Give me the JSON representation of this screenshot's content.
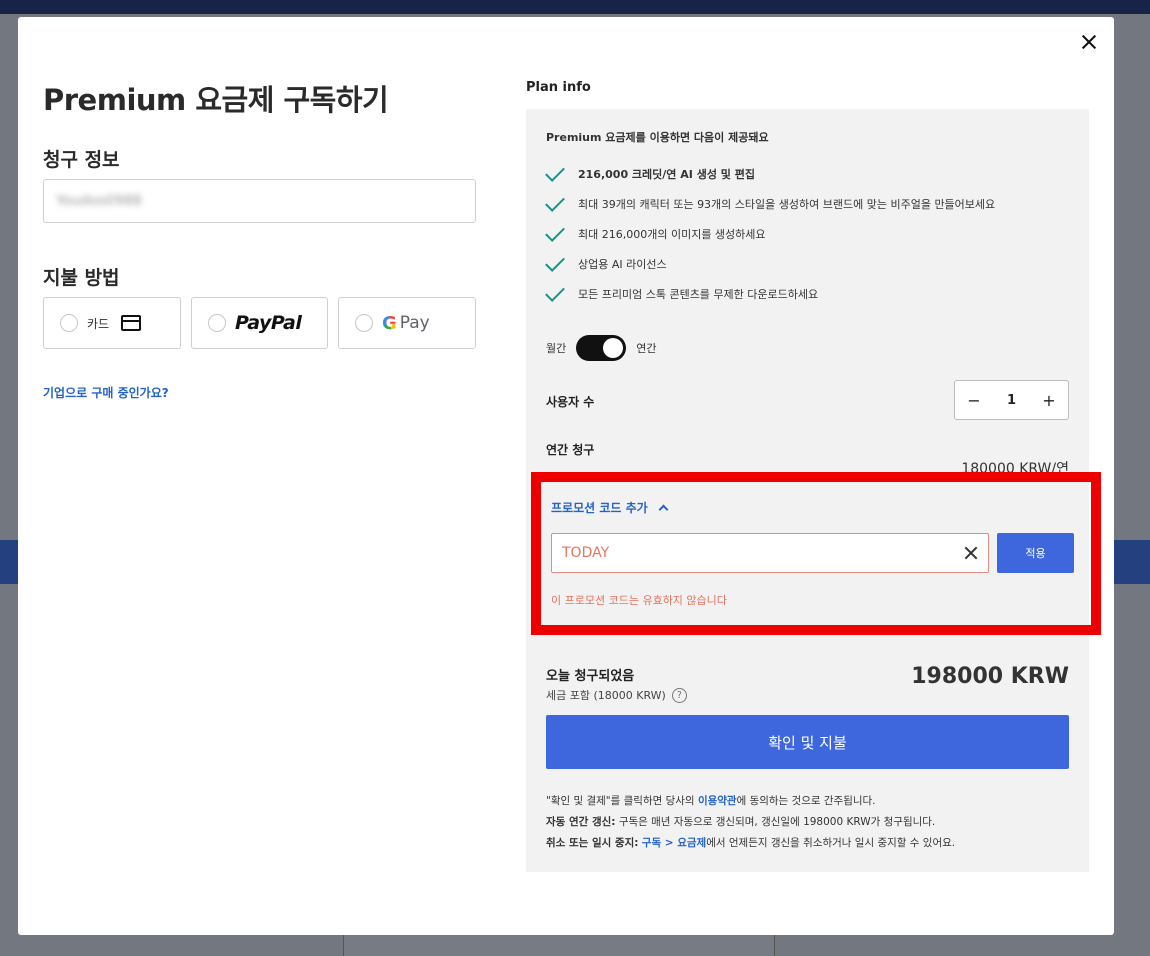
{
  "modal": {
    "title": "Premium 요금제 구독하기",
    "billing_section": "청구 정보",
    "billing_value": "Youdoo0988",
    "payment_section": "지불 방법",
    "payment_options": [
      {
        "label": "카드",
        "icon": "credit-card-icon"
      },
      {
        "label": "PayPal",
        "icon": "paypal-logo"
      },
      {
        "label": "Pay",
        "icon": "google-pay-logo"
      }
    ],
    "enterprise_link": "기업으로 구매 중인가요?"
  },
  "plan": {
    "heading": "Plan info",
    "intro": "Premium 요금제를 이용하면 다음이 제공돼요",
    "features": [
      "216,000 크레딧/연 AI 생성 및 편집",
      "최대 39개의 캐릭터 또는 93개의 스타일을 생성하여 브랜드에 맞는 비주얼을 만들어보세요",
      "최대 216,000개의 이미지를 생성하세요",
      "상업용 AI 라이선스",
      "모든 프리미엄 스톡 콘텐츠를 무제한 다운로드하세요"
    ],
    "toggle_monthly": "월간",
    "toggle_annual": "연간",
    "users_label": "사용자 수",
    "users_minus": "−",
    "users_value": "1",
    "users_plus": "+",
    "annual_label": "연간 청구",
    "annual_price": "180000 KRW/연"
  },
  "promo": {
    "toggle_label": "프로모션 코드 추가",
    "input_value": "TODAY",
    "apply_label": "적용",
    "error": "이 프로모션 코드는 유효하지 않습니다"
  },
  "summary": {
    "today_label": "오늘 청구되었음",
    "tax_text": "세금 포함 (18000 KRW)",
    "help": "?",
    "total": "198000 KRW",
    "confirm_label": "확인 및 지불"
  },
  "legal": {
    "line1_pre": "\"확인 및 결제\"를 클릭하면 당사의 ",
    "line1_link": "이용약관",
    "line1_post": "에 동의하는 것으로 간주됩니다.",
    "line2_bold": "자동 연간 갱신:",
    "line2_text": " 구독은 매년 자동으로 갱신되며, 갱신일에 198000 KRW가 청구됩니다.",
    "line3_bold": "취소 또는 일시 중지:",
    "line3_link": "구독 > 요금제",
    "line3_text": "에서 언제든지 갱신을 취소하거나 일시 중지할 수 있어요."
  },
  "colors": {
    "accent": "#3f67dd",
    "link": "#2563c9",
    "check": "#12968a",
    "error": "#e5735f",
    "highlight_border": "#ee0000"
  }
}
